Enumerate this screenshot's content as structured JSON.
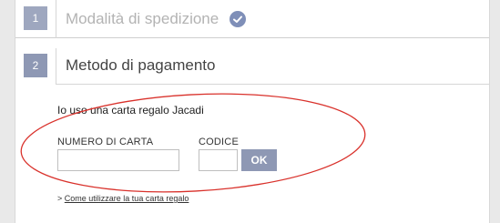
{
  "steps": [
    {
      "number": "1",
      "title": "Modalità di spedizione",
      "completed": true
    },
    {
      "number": "2",
      "title": "Metodo di pagamento",
      "completed": false
    }
  ],
  "gift_card": {
    "intro": "Io uso una carta regalo Jacadi",
    "card_number_label": "NUMERO DI CARTA",
    "card_number_value": "",
    "code_label": "CODICE",
    "code_value": "",
    "ok_label": "OK",
    "howto_prefix": ">",
    "howto_link": "Come utilizzare la tua carta regalo"
  },
  "colors": {
    "step_badge": "#8e98b4",
    "check_icon": "#7f8fb8",
    "annotation_ellipse": "#d9312b"
  }
}
